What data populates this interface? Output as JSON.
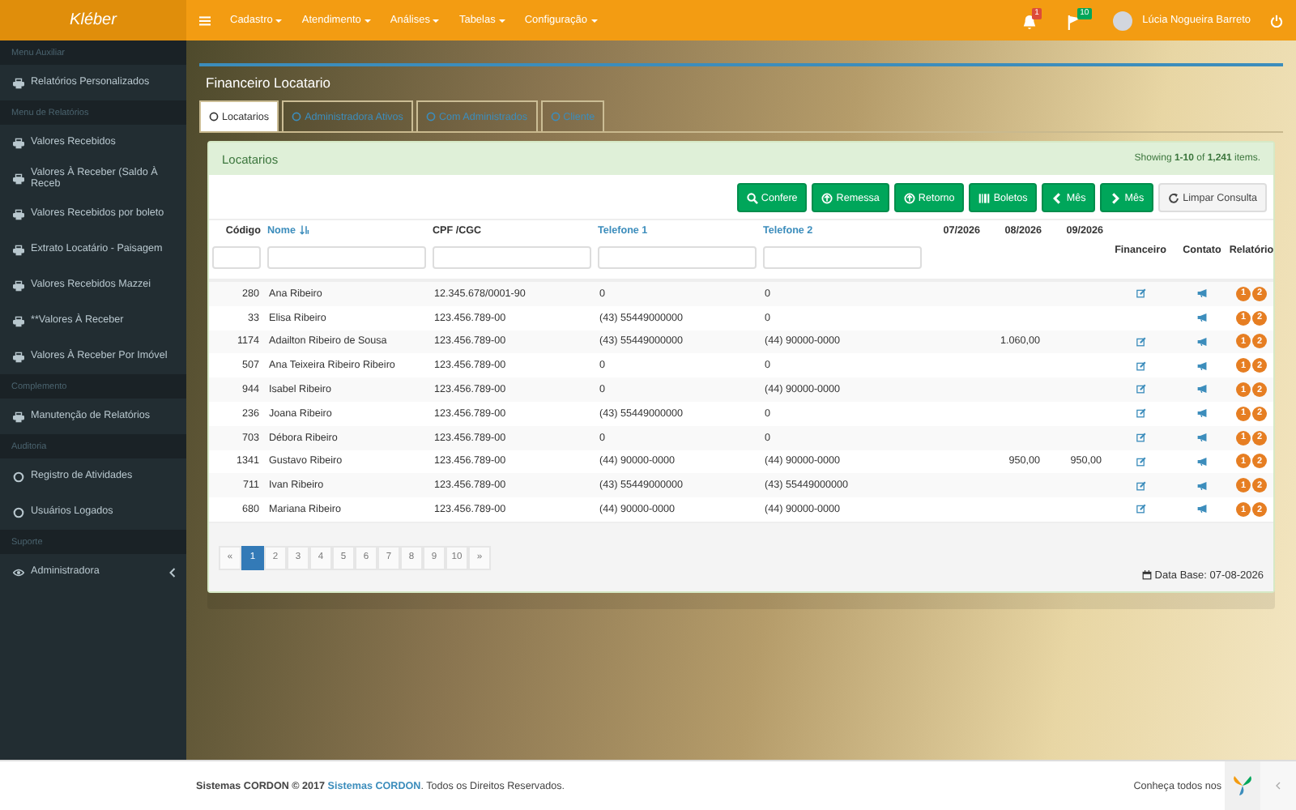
{
  "brand": "Kléber",
  "nav": [
    {
      "label": "Cadastro"
    },
    {
      "label": "Atendimento"
    },
    {
      "label": "Análises"
    },
    {
      "label": "Tabelas"
    },
    {
      "label": "Configuração"
    }
  ],
  "notifications": [
    {
      "kind": "bell",
      "count": "1",
      "color": "#dd4b39"
    },
    {
      "kind": "flag",
      "count": "10",
      "color": "#00a65a"
    }
  ],
  "user": {
    "name": "Lúcia Nogueira Barreto"
  },
  "sidebar": [
    {
      "kind": "header",
      "label": "Menu Auxiliar"
    },
    {
      "kind": "report",
      "label": "Relatórios Personalizados"
    },
    {
      "kind": "header",
      "label": "Menu de Relatórios"
    },
    {
      "kind": "report",
      "label": "Valores Recebidos"
    },
    {
      "kind": "report",
      "label": "Valores À Receber (Saldo À Receb"
    },
    {
      "kind": "report",
      "label": "Valores Recebidos por boleto"
    },
    {
      "kind": "report",
      "label": "Extrato Locatário - Paisagem"
    },
    {
      "kind": "report",
      "label": "Valores Recebidos Mazzei"
    },
    {
      "kind": "report",
      "label": "**Valores À Receber"
    },
    {
      "kind": "report",
      "label": "Valores À Receber Por Imóvel"
    },
    {
      "kind": "header",
      "label": "Complemento"
    },
    {
      "kind": "report",
      "label": "Manutenção de Relatórios"
    },
    {
      "kind": "header",
      "label": "Auditoria"
    },
    {
      "kind": "log",
      "label": "Registro de Atividades"
    },
    {
      "kind": "log",
      "label": "Usuários Logados"
    },
    {
      "kind": "header",
      "label": "Suporte"
    },
    {
      "kind": "admin",
      "label": "Administradora",
      "expandable": true
    }
  ],
  "page_title": "Financeiro Locatario",
  "tabs": [
    {
      "label": "Locatarios",
      "selected": true
    },
    {
      "label": "Administradora Ativos",
      "selected": false
    },
    {
      "label": "Com Administrados",
      "selected": false
    },
    {
      "label": "Cliente",
      "selected": false
    }
  ],
  "panel": {
    "title": "Locatarios",
    "summary": "Showing **1-10** of **1,241** items."
  },
  "buttons": [
    {
      "label": "Confere",
      "kind": "search"
    },
    {
      "label": "Remessa",
      "kind": "upload"
    },
    {
      "label": "Retorno",
      "kind": "upload"
    },
    {
      "label": "Boletos",
      "kind": "barcode"
    },
    {
      "label": "Mês",
      "kind": "previous"
    },
    {
      "label": "Mês",
      "kind": "next"
    },
    {
      "label": "Limpar Consulta",
      "kind": "reset"
    }
  ],
  "columns": [
    {
      "label": "Código",
      "link": false,
      "sorted": false
    },
    {
      "label": "Nome",
      "link": true,
      "sorted": true
    },
    {
      "label": "CPF /CGC",
      "link": false,
      "sorted": false
    },
    {
      "label": "Telefone 1",
      "link": true,
      "sorted": false
    },
    {
      "label": "Telefone 2",
      "link": true,
      "sorted": false
    },
    {
      "label": "07/2026",
      "link": false,
      "sorted": false
    },
    {
      "label": "08/2026",
      "link": false,
      "sorted": false
    },
    {
      "label": "09/2026",
      "link": false,
      "sorted": false
    },
    {
      "label": "Financeiro",
      "link": false,
      "sorted": false
    },
    {
      "label": "Contato",
      "link": false,
      "sorted": false
    },
    {
      "label": "Relatório",
      "link": false,
      "sorted": false
    }
  ],
  "rows": [
    {
      "cells": [
        "280",
        "Ana Ribeiro",
        "12.345.678/0001-90",
        "0",
        "0",
        "",
        "",
        ""
      ],
      "edit": true,
      "reports": [
        "1",
        "2"
      ]
    },
    {
      "cells": [
        "33",
        "Elisa Ribeiro",
        "123.456.789-00",
        "(43) 55449000000",
        "0",
        "",
        "",
        ""
      ],
      "edit": false,
      "reports": [
        "1",
        "2"
      ]
    },
    {
      "cells": [
        "1174",
        "Adailton Ribeiro de Sousa",
        "123.456.789-00",
        "(43) 55449000000",
        "(44) 90000-0000",
        "",
        "1.060,00",
        ""
      ],
      "edit": true,
      "reports": [
        "1",
        "2"
      ]
    },
    {
      "cells": [
        "507",
        "Ana Teixeira Ribeiro Ribeiro",
        "123.456.789-00",
        "0",
        "0",
        "",
        "",
        ""
      ],
      "edit": true,
      "reports": [
        "1",
        "2"
      ]
    },
    {
      "cells": [
        "944",
        "Isabel Ribeiro",
        "123.456.789-00",
        "0",
        "(44) 90000-0000",
        "",
        "",
        ""
      ],
      "edit": true,
      "reports": [
        "1",
        "2"
      ]
    },
    {
      "cells": [
        "236",
        "Joana Ribeiro",
        "123.456.789-00",
        "(43) 55449000000",
        "0",
        "",
        "",
        ""
      ],
      "edit": true,
      "reports": [
        "1",
        "2"
      ]
    },
    {
      "cells": [
        "703",
        "Débora Ribeiro",
        "123.456.789-00",
        "0",
        "0",
        "",
        "",
        ""
      ],
      "edit": true,
      "reports": [
        "1",
        "2"
      ]
    },
    {
      "cells": [
        "1341",
        "Gustavo Ribeiro",
        "123.456.789-00",
        "(44) 90000-0000",
        "(44) 90000-0000",
        "",
        "950,00",
        "950,00"
      ],
      "edit": true,
      "reports": [
        "1",
        "2"
      ]
    },
    {
      "cells": [
        "711",
        "Ivan Ribeiro",
        "123.456.789-00",
        "(43) 55449000000",
        "(43) 55449000000",
        "",
        "",
        ""
      ],
      "edit": true,
      "reports": [
        "1",
        "2"
      ]
    },
    {
      "cells": [
        "680",
        "Mariana Ribeiro",
        "123.456.789-00",
        "(44) 90000-0000",
        "(44) 90000-0000",
        "",
        "",
        ""
      ],
      "edit": true,
      "reports": [
        "1",
        "2"
      ]
    }
  ],
  "pagination": [
    {
      "label": "«",
      "selected": false
    },
    {
      "label": "1",
      "selected": true
    },
    {
      "label": "2",
      "selected": false
    },
    {
      "label": "3",
      "selected": false
    },
    {
      "label": "4",
      "selected": false
    },
    {
      "label": "5",
      "selected": false
    },
    {
      "label": "6",
      "selected": false
    },
    {
      "label": "7",
      "selected": false
    },
    {
      "label": "8",
      "selected": false
    },
    {
      "label": "9",
      "selected": false
    },
    {
      "label": "10",
      "selected": false
    },
    {
      "label": "»",
      "selected": false
    }
  ],
  "database_date": "Data Base: 07-08-2026",
  "footer": {
    "owner": "Sistemas CORDON © 2017",
    "link": "Sistemas CORDON",
    "rest": ". Todos os Direitos Reservados.",
    "right": "Conheça todos nos"
  }
}
